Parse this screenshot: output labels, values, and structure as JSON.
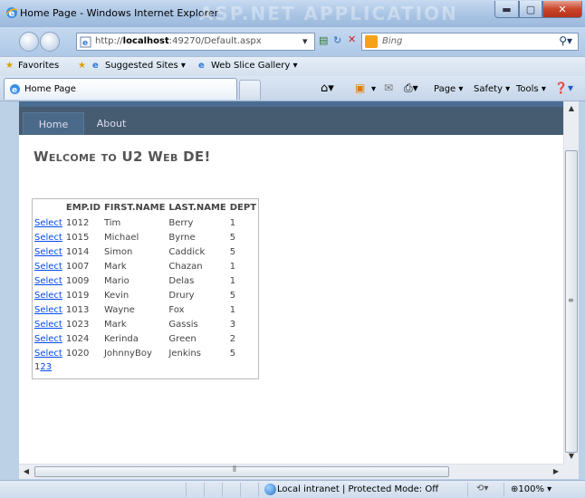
{
  "window": {
    "title": "Home Page - Windows Internet Explorer",
    "watermark": "ASP.NET APPLICATION"
  },
  "address": {
    "url_prefix": "http://",
    "url_host": "localhost",
    "url_rest": ":49270/Default.aspx"
  },
  "search": {
    "placeholder": "Bing"
  },
  "favorites": {
    "favorites_label": "Favorites",
    "suggested_label": "Suggested Sites ▾",
    "webslice_label": "Web Slice Gallery ▾"
  },
  "tab": {
    "label": "Home Page"
  },
  "commandbar": {
    "page_label": "Page ▾",
    "safety_label": "Safety ▾",
    "tools_label": "Tools ▾"
  },
  "site": {
    "nav": {
      "home": "Home",
      "about": "About"
    },
    "heading": "Welcome to U2 Web DE!"
  },
  "grid": {
    "columns": [
      "EMP.ID",
      "FIRST.NAME",
      "LAST.NAME",
      "DEPT"
    ],
    "select_label": "Select",
    "rows": [
      [
        "1012",
        "Tim",
        "Berry",
        "1"
      ],
      [
        "1015",
        "Michael",
        "Byrne",
        "5"
      ],
      [
        "1014",
        "Simon",
        "Caddick",
        "5"
      ],
      [
        "1007",
        "Mark",
        "Chazan",
        "1"
      ],
      [
        "1009",
        "Mario",
        "Delas",
        "1"
      ],
      [
        "1019",
        "Kevin",
        "Drury",
        "5"
      ],
      [
        "1013",
        "Wayne",
        "Fox",
        "1"
      ],
      [
        "1023",
        "Mark",
        "Gassis",
        "3"
      ],
      [
        "1024",
        "Kerinda",
        "Green",
        "2"
      ],
      [
        "1020",
        "JohnnyBoy",
        "Jenkins",
        "5"
      ]
    ],
    "pager": {
      "current": "1",
      "pages": [
        "2",
        "3"
      ]
    }
  },
  "statusbar": {
    "zone": "Local intranet | Protected Mode: Off",
    "zoom": "100%"
  }
}
